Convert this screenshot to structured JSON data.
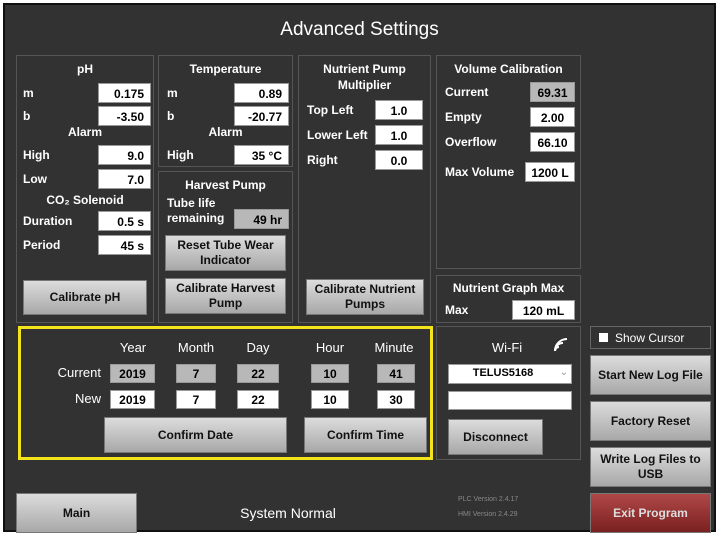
{
  "title": "Advanced Settings",
  "ph": {
    "heading": "pH",
    "m_label": "m",
    "m_value": "0.175",
    "b_label": "b",
    "b_value": "-3.50",
    "alarm_heading": "Alarm",
    "high_label": "High",
    "high_value": "9.0",
    "low_label": "Low",
    "low_value": "7.0",
    "co2_heading": "CO₂ Solenoid",
    "duration_label": "Duration",
    "duration_value": "0.5 s",
    "period_label": "Period",
    "period_value": "45 s",
    "calibrate_button": "Calibrate pH"
  },
  "temperature": {
    "heading": "Temperature",
    "m_label": "m",
    "m_value": "0.89",
    "b_label": "b",
    "b_value": "-20.77",
    "alarm_heading": "Alarm",
    "high_label": "High",
    "high_value": "35 °C"
  },
  "harvest_pump": {
    "heading": "Harvest Pump",
    "tube_life_label_1": "Tube life",
    "tube_life_label_2": "remaining",
    "tube_life_value": "49 hr",
    "reset_button_1": "Reset Tube Wear",
    "reset_button_2": "Indicator",
    "calibrate_button_1": "Calibrate Harvest",
    "calibrate_button_2": "Pump"
  },
  "nutrient_pump": {
    "heading_1": "Nutrient Pump",
    "heading_2": "Multiplier",
    "top_left_label": "Top Left",
    "top_left_value": "1.0",
    "lower_left_label": "Lower Left",
    "lower_left_value": "1.0",
    "right_label": "Right",
    "right_value": "0.0",
    "calibrate_button_1": "Calibrate Nutrient",
    "calibrate_button_2": "Pumps"
  },
  "volume": {
    "heading": "Volume Calibration",
    "current_label": "Current",
    "current_value": "69.31",
    "empty_label": "Empty",
    "empty_value": "2.00",
    "overflow_label": "Overflow",
    "overflow_value": "66.10",
    "max_volume_label": "Max Volume",
    "max_volume_value": "1200 L"
  },
  "nutrient_graph": {
    "heading": "Nutrient Graph Max",
    "max_label": "Max",
    "max_value": "120 mL"
  },
  "datetime": {
    "headers": [
      "Year",
      "Month",
      "Day",
      "Hour",
      "Minute"
    ],
    "current_label": "Current",
    "new_label": "New",
    "current": [
      "2019",
      "7",
      "22",
      "10",
      "41"
    ],
    "new": [
      "2019",
      "7",
      "22",
      "10",
      "30"
    ],
    "confirm_date": "Confirm Date",
    "confirm_time": "Confirm Time"
  },
  "wifi": {
    "label": "Wi-Fi",
    "network": "TELUS5168",
    "password": "",
    "disconnect_button": "Disconnect"
  },
  "right_panel": {
    "show_cursor": "Show Cursor",
    "show_cursor_checked": true,
    "start_log": "Start New Log File",
    "factory_reset": "Factory Reset",
    "write_logs_1": "Write Log Files to",
    "write_logs_2": "USB",
    "exit": "Exit Program"
  },
  "footer": {
    "main_button": "Main",
    "status": "System Normal",
    "plc_version": "PLC Version 2.4.17",
    "hmi_version": "HMI Version 2.4.29"
  },
  "colors": {
    "background": "#323232",
    "highlight_border": "#f2e31a",
    "exit_button": "#8e2c2c"
  }
}
